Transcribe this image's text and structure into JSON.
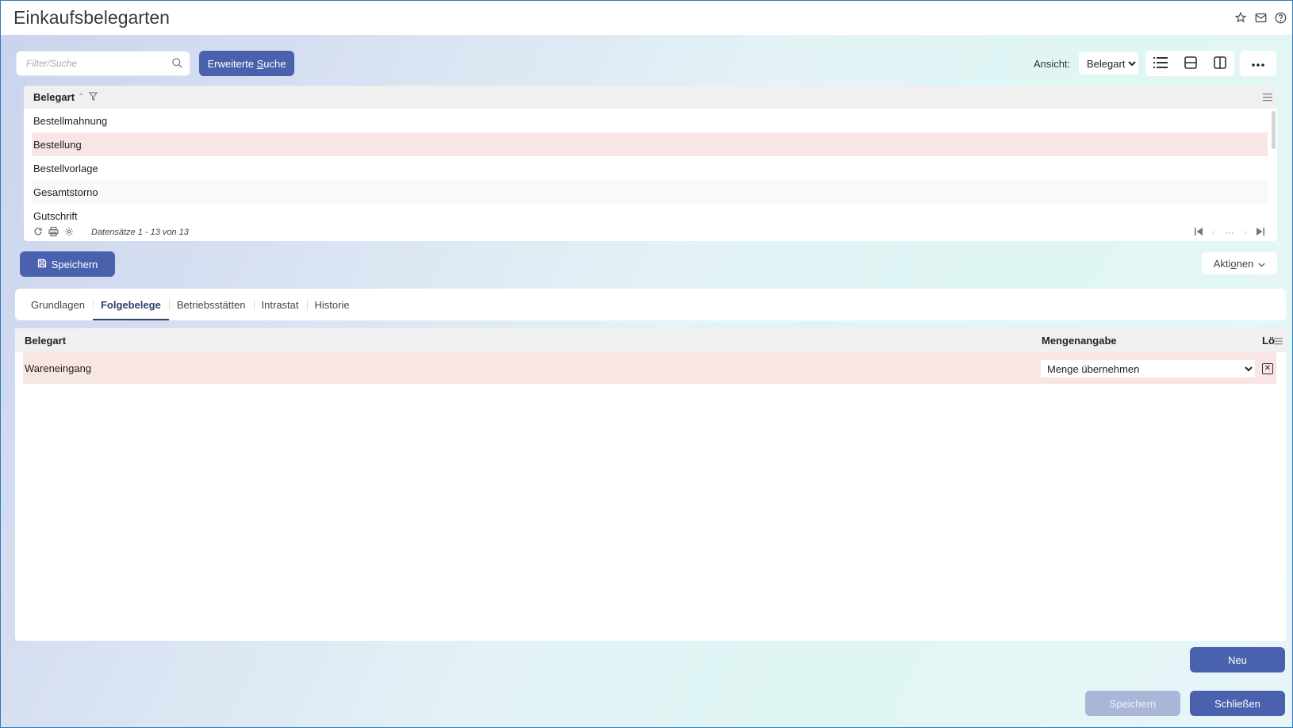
{
  "header": {
    "title": "Einkaufsbelegarten",
    "icons": [
      "star-icon",
      "mail-icon",
      "help-icon"
    ]
  },
  "toolbar": {
    "search_placeholder": "Filter/Suche",
    "advanced_search_pre": "Erweiterte ",
    "advanced_search_u": "S",
    "advanced_search_post": "uche",
    "view_label": "Ansicht:",
    "view_value": "Belegart"
  },
  "grid": {
    "column_header": "Belegart",
    "rows": [
      "Bestellmahnung",
      "Bestellung",
      "Bestellvorlage",
      "Gesamtstorno",
      "Gutschrift"
    ],
    "selected_row": "Bestellung",
    "records_text": "Datensätze 1 - 13 von 13"
  },
  "actions": {
    "save_label": "Speichern",
    "aktionen_pre": "Akti",
    "aktionen_u": "o",
    "aktionen_post": "nen"
  },
  "tabs": [
    {
      "label": "Grundlagen",
      "active": false
    },
    {
      "label": "Folgebelege",
      "active": true
    },
    {
      "label": "Betriebsstätten",
      "active": false
    },
    {
      "label": "Intrastat",
      "active": false
    },
    {
      "label": "Historie",
      "active": false
    }
  ],
  "detail": {
    "columns": [
      "Belegart",
      "Mengenangabe",
      "Löschen"
    ],
    "rows": [
      {
        "belegart": "Wareneingang",
        "mengenangabe": "Menge übernehmen"
      }
    ]
  },
  "footer": {
    "new_label": "Neu",
    "save_label": "Speichern",
    "close_label": "Schließen"
  },
  "colors": {
    "primary": "#4a62ad",
    "selected_row": "#f7e6e4",
    "disabled_button": "#a9b6d8"
  }
}
